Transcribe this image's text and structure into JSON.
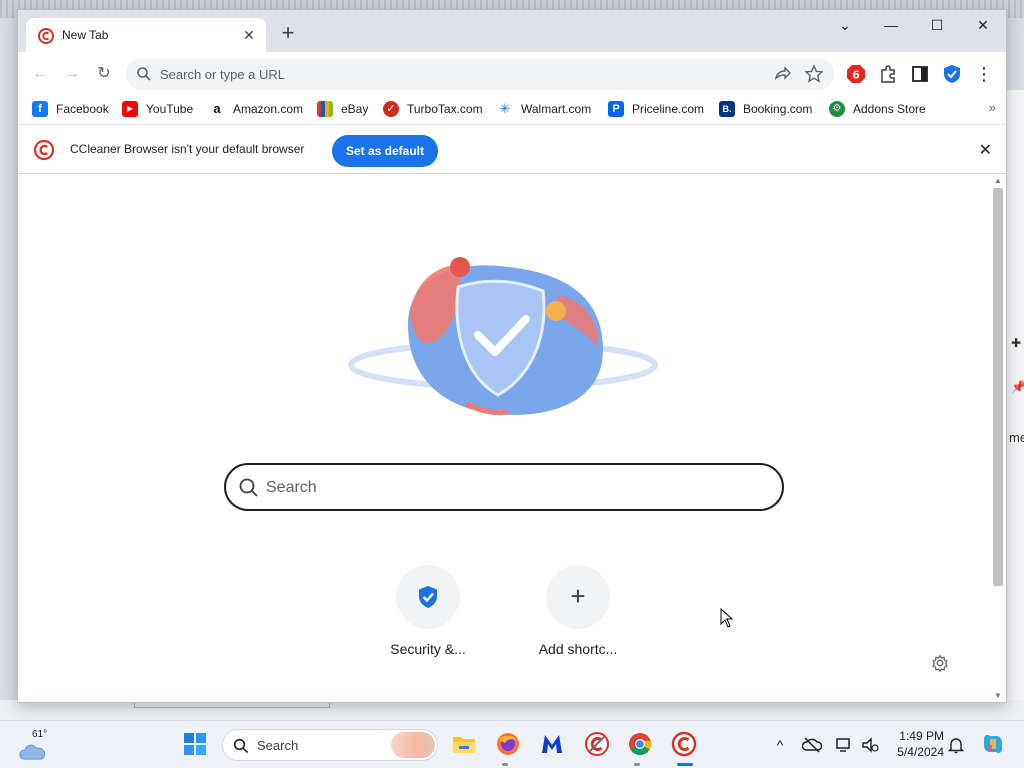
{
  "browser": {
    "tab": {
      "title": "New Tab",
      "close_symbol": "✕"
    },
    "new_tab_symbol": "+",
    "window_controls": {
      "minimize": "—",
      "maximize": "☐",
      "close": "✕",
      "tab_search": "⌄"
    },
    "nav": {
      "back": "←",
      "forward": "→",
      "reload": "↻"
    },
    "omnibox": {
      "placeholder": "Search or type a URL",
      "share_icon": "share-icon",
      "star_icon": "star-icon"
    },
    "extensions": [
      "adblock-icon",
      "puzzle-icon",
      "sidebar-icon",
      "shield-icon",
      "menu-icon"
    ],
    "menu_symbol": "⋮"
  },
  "bookmarks": {
    "items": [
      {
        "label": "Facebook",
        "icon": "facebook-icon",
        "color": "#1877f2",
        "glyph": "f"
      },
      {
        "label": "YouTube",
        "icon": "youtube-icon",
        "color": "#ff0000",
        "glyph": "▶"
      },
      {
        "label": "Amazon.com",
        "icon": "amazon-icon",
        "color": "#ffffff",
        "glyph": "a"
      },
      {
        "label": "eBay",
        "icon": "ebay-icon",
        "color": "#e53238",
        "glyph": ""
      },
      {
        "label": "TurboTax.com",
        "icon": "turbotax-icon",
        "color": "#d52b1e",
        "glyph": "✓"
      },
      {
        "label": "Walmart.com",
        "icon": "walmart-icon",
        "color": "#0071ce",
        "glyph": "✳"
      },
      {
        "label": "Priceline.com",
        "icon": "priceline-icon",
        "color": "#0068ef",
        "glyph": "P"
      },
      {
        "label": "Booking.com",
        "icon": "booking-icon",
        "color": "#003580",
        "glyph": "B."
      },
      {
        "label": "Addons Store",
        "icon": "addons-icon",
        "color": "#1e8e3e",
        "glyph": "⚙"
      }
    ],
    "more_symbol": "»"
  },
  "infobar": {
    "message": "CCleaner Browser isn't your default browser",
    "button": "Set as default",
    "close_symbol": "✕"
  },
  "ntp": {
    "search_placeholder": "Search",
    "shortcuts": [
      {
        "label": "Security &...",
        "icon": "shield-icon"
      },
      {
        "label": "Add shortc...",
        "icon": "plus-icon",
        "symbol": "+"
      }
    ],
    "settings_icon": "gear-icon"
  },
  "taskbar": {
    "weather": {
      "temp": "61°",
      "icon": "cloud-icon"
    },
    "search_label": "Search",
    "apps": [
      "windows-start-icon",
      "file-explorer-icon",
      "firefox-icon",
      "malwarebytes-icon",
      "ccleaner-icon",
      "chrome-icon",
      "ccleaner-browser-icon"
    ],
    "tray": {
      "chevron": "^",
      "time": "1:49 PM",
      "date": "5/4/2024"
    }
  },
  "background_window": {
    "side_text": "me"
  },
  "colors": {
    "accent": "#1a73e8",
    "tab_strip": "#dee1e6",
    "ccleaner_red": "#d93025"
  }
}
